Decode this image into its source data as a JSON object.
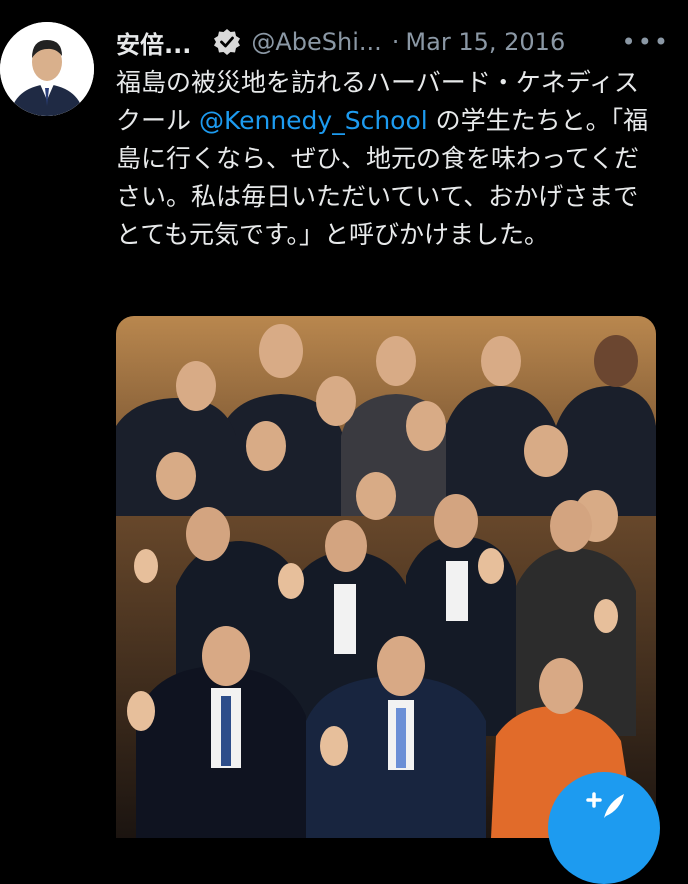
{
  "tweet": {
    "author_name": "安倍...",
    "author_handle": "@AbeShi...",
    "separator": "·",
    "date": "Mar 15, 2016",
    "more_label": "•••",
    "text_part1": "福島の被災地を訪れるハーバード・ケネディスクール ",
    "mention": "@Kennedy_School",
    "text_part2": " の学生たちと。「福島に行くなら、ぜひ、地元の食を味わってください。私は毎日いただいていて、おかげさまでとても元気です。」と呼びかけました。"
  },
  "colors": {
    "background": "#000000",
    "text": "#e7e9ea",
    "secondary": "#8b98a5",
    "accent": "#1d9bf0"
  },
  "icons": {
    "verified": "verified-badge-icon",
    "more": "more-icon",
    "compose": "compose-tweet-icon"
  }
}
